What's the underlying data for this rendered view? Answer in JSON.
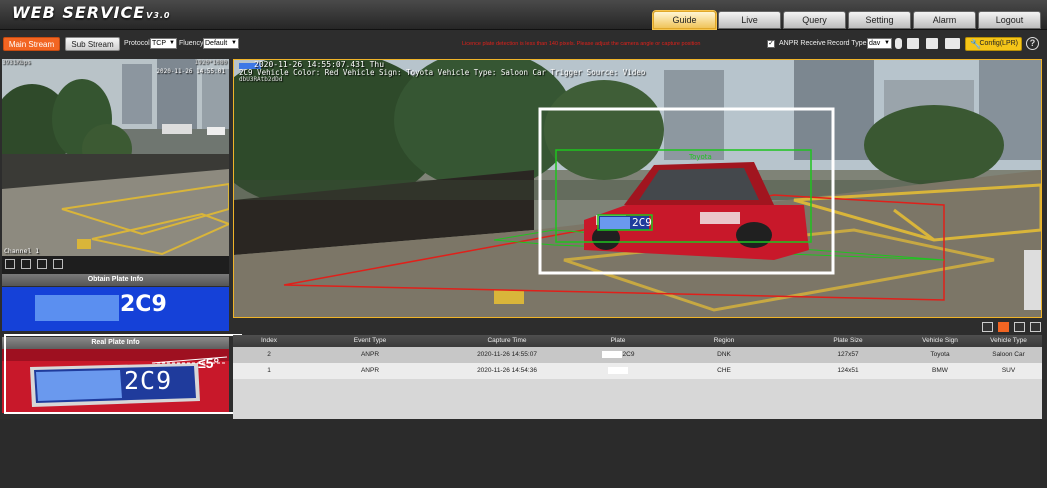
{
  "header": {
    "logo_text": "WEB SERVICE",
    "logo_version": "V3.0",
    "nav_tabs": [
      {
        "label": "Guide",
        "active": true
      },
      {
        "label": "Live",
        "active": false
      },
      {
        "label": "Query",
        "active": false
      },
      {
        "label": "Setting",
        "active": false
      },
      {
        "label": "Alarm",
        "active": false
      },
      {
        "label": "Logout",
        "active": false
      }
    ]
  },
  "toolbar": {
    "main_stream_label": "Main Stream",
    "sub_stream_label": "Sub Stream",
    "protocol_label": "Protocol",
    "protocol_value": "TCP",
    "fluency_label": "Fluency",
    "fluency_value": "Default",
    "warning_text": "Licence plate detection is less than 140 pixels. Please adjust the camera angle or capture position",
    "anpr_receive_label": "ANPR Receive",
    "anpr_receive_checked": true,
    "record_type_label": "Record Type",
    "record_type_value": "dav",
    "config_label": "Config(LPR)",
    "icons": [
      "microphone-icon",
      "snapshot-icon",
      "record-icon",
      "camera-icon"
    ]
  },
  "small_view": {
    "bitrate": "3931Kbps",
    "resolution": "1920*1080",
    "timestamp": "2020-11-26 14:55:01",
    "channel": "Channel 1"
  },
  "obtain_plate": {
    "title": "Obtain Plate Info",
    "plate_suffix": "2C9"
  },
  "real_plate": {
    "title": "Real Plate Info",
    "plate_suffix": "2C9",
    "angle_note": "≤5°"
  },
  "main_view": {
    "osd_time": "2020-11-26 14:55:07.431 Thu",
    "osd_info": "2C9 Vehicle Color: Red Vehicle Sign: Toyota Vehicle Type: Saloon Car Trigger Source: Video",
    "osd_line2": "dbU3RAtb2dDd"
  },
  "table": {
    "headers": [
      "Index",
      "Event Type",
      "Capture Time",
      "Plate",
      "Region",
      "Plate Size",
      "Vehicle Sign",
      "Vehicle Type"
    ],
    "rows": [
      {
        "index": "2",
        "event": "ANPR",
        "time": "2020-11-26 14:55:07",
        "plate": "2C9",
        "region": "DNK",
        "size": "127x57",
        "sign": "Toyota",
        "type": "Saloon Car"
      },
      {
        "index": "1",
        "event": "ANPR",
        "time": "2020-11-26 14:54:36",
        "plate": "",
        "region": "CHE",
        "size": "124x51",
        "sign": "BMW",
        "type": "SUV"
      }
    ]
  },
  "colors": {
    "accent_orange": "#f26522",
    "plate_blue": "#1541d8",
    "detect_green": "#1fc41f",
    "zone_red": "#e0201a"
  }
}
